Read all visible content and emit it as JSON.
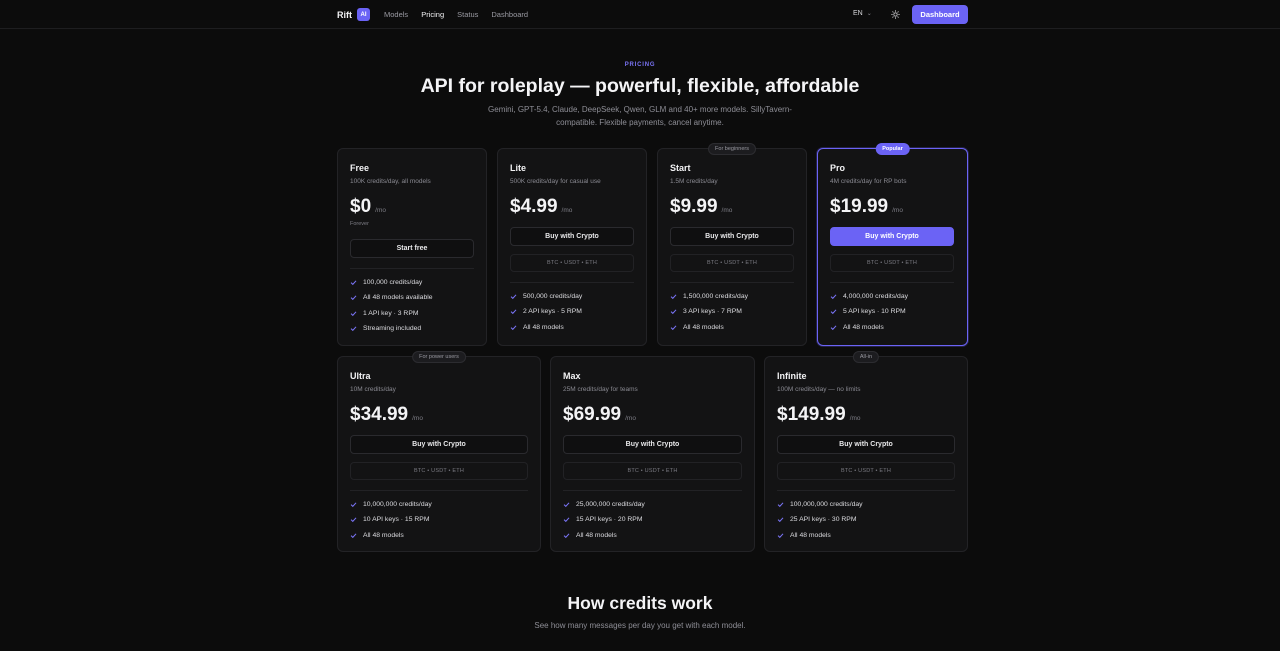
{
  "nav": {
    "brand": "Rift",
    "brand_badge": "AI",
    "links": [
      "Models",
      "Pricing",
      "Status",
      "Dashboard"
    ],
    "active_link": "Pricing",
    "language": "EN",
    "dashboard_button": "Dashboard"
  },
  "hero": {
    "eyebrow": "PRICING",
    "title": "API for roleplay — powerful, flexible, affordable",
    "subtitle": "Gemini, GPT-5.4, Claude, DeepSeek, Qwen, GLM and 40+ more models. SillyTavern-compatible. Flexible payments, cancel anytime."
  },
  "plans": [
    {
      "name": "Free",
      "tagline": "100K credits/day, all models",
      "price": "$0",
      "period": "/mo",
      "note": "Forever",
      "button": "Start free",
      "payments": "",
      "features": [
        "100,000 credits/day",
        "All 48 models available",
        "1 API key · 3 RPM",
        "Streaming included"
      ]
    },
    {
      "name": "Lite",
      "tagline": "500K credits/day for casual use",
      "price": "$4.99",
      "period": "/mo",
      "button": "Buy with Crypto",
      "payments": "BTC • USDT • ETH",
      "features": [
        "500,000 credits/day",
        "2 API keys · 5 RPM",
        "All 48 models"
      ]
    },
    {
      "name": "Start",
      "tagline": "1.5M credits/day",
      "price": "$9.99",
      "period": "/mo",
      "badge": "For beginners",
      "button": "Buy with Crypto",
      "payments": "BTC • USDT • ETH",
      "features": [
        "1,500,000 credits/day",
        "3 API keys · 7 RPM",
        "All 48 models"
      ]
    },
    {
      "name": "Pro",
      "tagline": "4M credits/day for RP bots",
      "price": "$19.99",
      "period": "/mo",
      "badge": "Popular",
      "button": "Buy with Crypto",
      "payments": "BTC • USDT • ETH",
      "features": [
        "4,000,000 credits/day",
        "5 API keys · 10 RPM",
        "All 48 models"
      ]
    },
    {
      "name": "Ultra",
      "tagline": "10M credits/day",
      "price": "$34.99",
      "period": "/mo",
      "badge": "For power users",
      "button": "Buy with Crypto",
      "payments": "BTC • USDT • ETH",
      "features": [
        "10,000,000 credits/day",
        "10 API keys · 15 RPM",
        "All 48 models"
      ]
    },
    {
      "name": "Max",
      "tagline": "25M credits/day for teams",
      "price": "$69.99",
      "period": "/mo",
      "button": "Buy with Crypto",
      "payments": "BTC • USDT • ETH",
      "features": [
        "25,000,000 credits/day",
        "15 API keys · 20 RPM",
        "All 48 models"
      ]
    },
    {
      "name": "Infinite",
      "tagline": "100M credits/day — no limits",
      "price": "$149.99",
      "period": "/mo",
      "badge": "All-in",
      "button": "Buy with Crypto",
      "payments": "BTC • USDT • ETH",
      "features": [
        "100,000,000 credits/day",
        "25 API keys · 30 RPM",
        "All 48 models"
      ]
    }
  ],
  "credits_section": {
    "title": "How credits work",
    "subtitle": "See how many messages per day you get with each model."
  },
  "colors": {
    "accent": "#6b63f5",
    "background": "#0c0c0c",
    "card": "#131314"
  },
  "icons": {
    "check": "check-icon",
    "theme": "sun-icon",
    "language_dropdown": "chevron-down-icon"
  }
}
